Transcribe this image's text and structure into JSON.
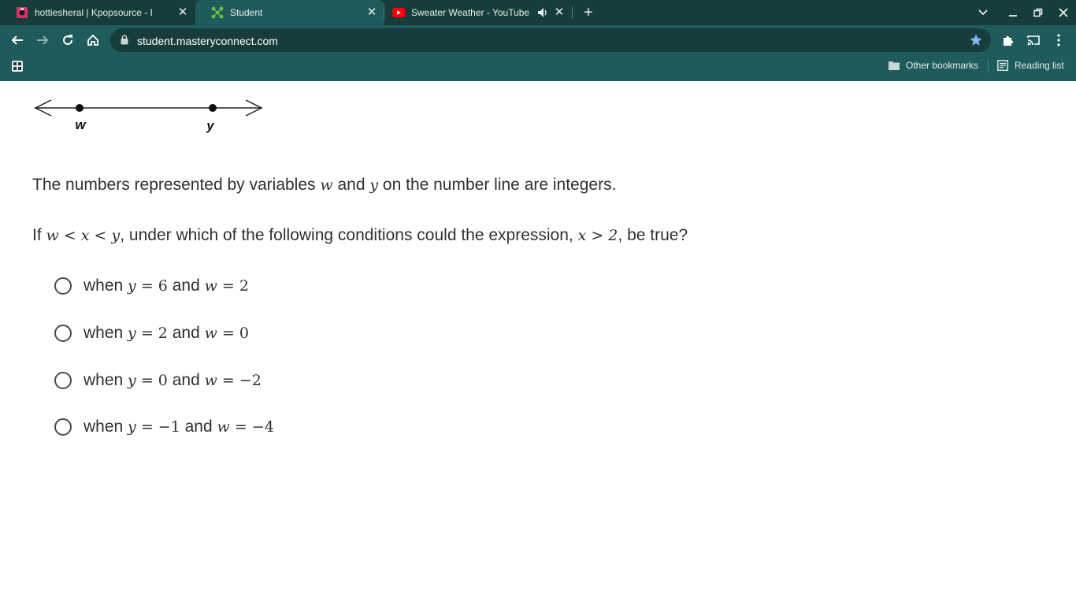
{
  "browser": {
    "tabs": [
      {
        "title": "hottiesheral | Kpopsource - Intern",
        "active": false,
        "icon": "kpopsource-favicon"
      },
      {
        "title": "Student",
        "active": true,
        "icon": "masteryconnect-favicon"
      },
      {
        "title": "Sweater Weather - YouTube",
        "active": false,
        "icon": "youtube-favicon",
        "audio": true
      }
    ],
    "url": "student.masteryconnect.com",
    "bookmarks": {
      "other": "Other bookmarks",
      "reading_list": "Reading list"
    },
    "colors": {
      "frame": "#173c3c",
      "toolbar": "#1e5b5a",
      "star": "#8ab4f8"
    }
  },
  "question": {
    "number_line": {
      "labels": [
        "w",
        "y"
      ]
    },
    "line1": {
      "pre": "The numbers represented by variables ",
      "var_w": "w",
      "mid": " and ",
      "var_y": "y",
      "post": " on the number line are integers."
    },
    "line2": {
      "pre": "If ",
      "math1": "w < x < y",
      "mid": ", under which of the following conditions could the expression, ",
      "math2": "x > 2",
      "post": ", be true?"
    },
    "options": [
      {
        "when": "when ",
        "ylhs": "y",
        "yrhs": " = 6",
        "and": " and ",
        "wlhs": "w",
        "wrhs": " = 2"
      },
      {
        "when": "when ",
        "ylhs": "y",
        "yrhs": " = 2",
        "and": " and ",
        "wlhs": "w",
        "wrhs": " = 0"
      },
      {
        "when": "when ",
        "ylhs": "y",
        "yrhs": " = 0",
        "and": " and ",
        "wlhs": "w",
        "wrhs": " = −2"
      },
      {
        "when": "when ",
        "ylhs": "y",
        "yrhs": " = −1",
        "and": " and ",
        "wlhs": "w",
        "wrhs": " = −4"
      }
    ]
  }
}
